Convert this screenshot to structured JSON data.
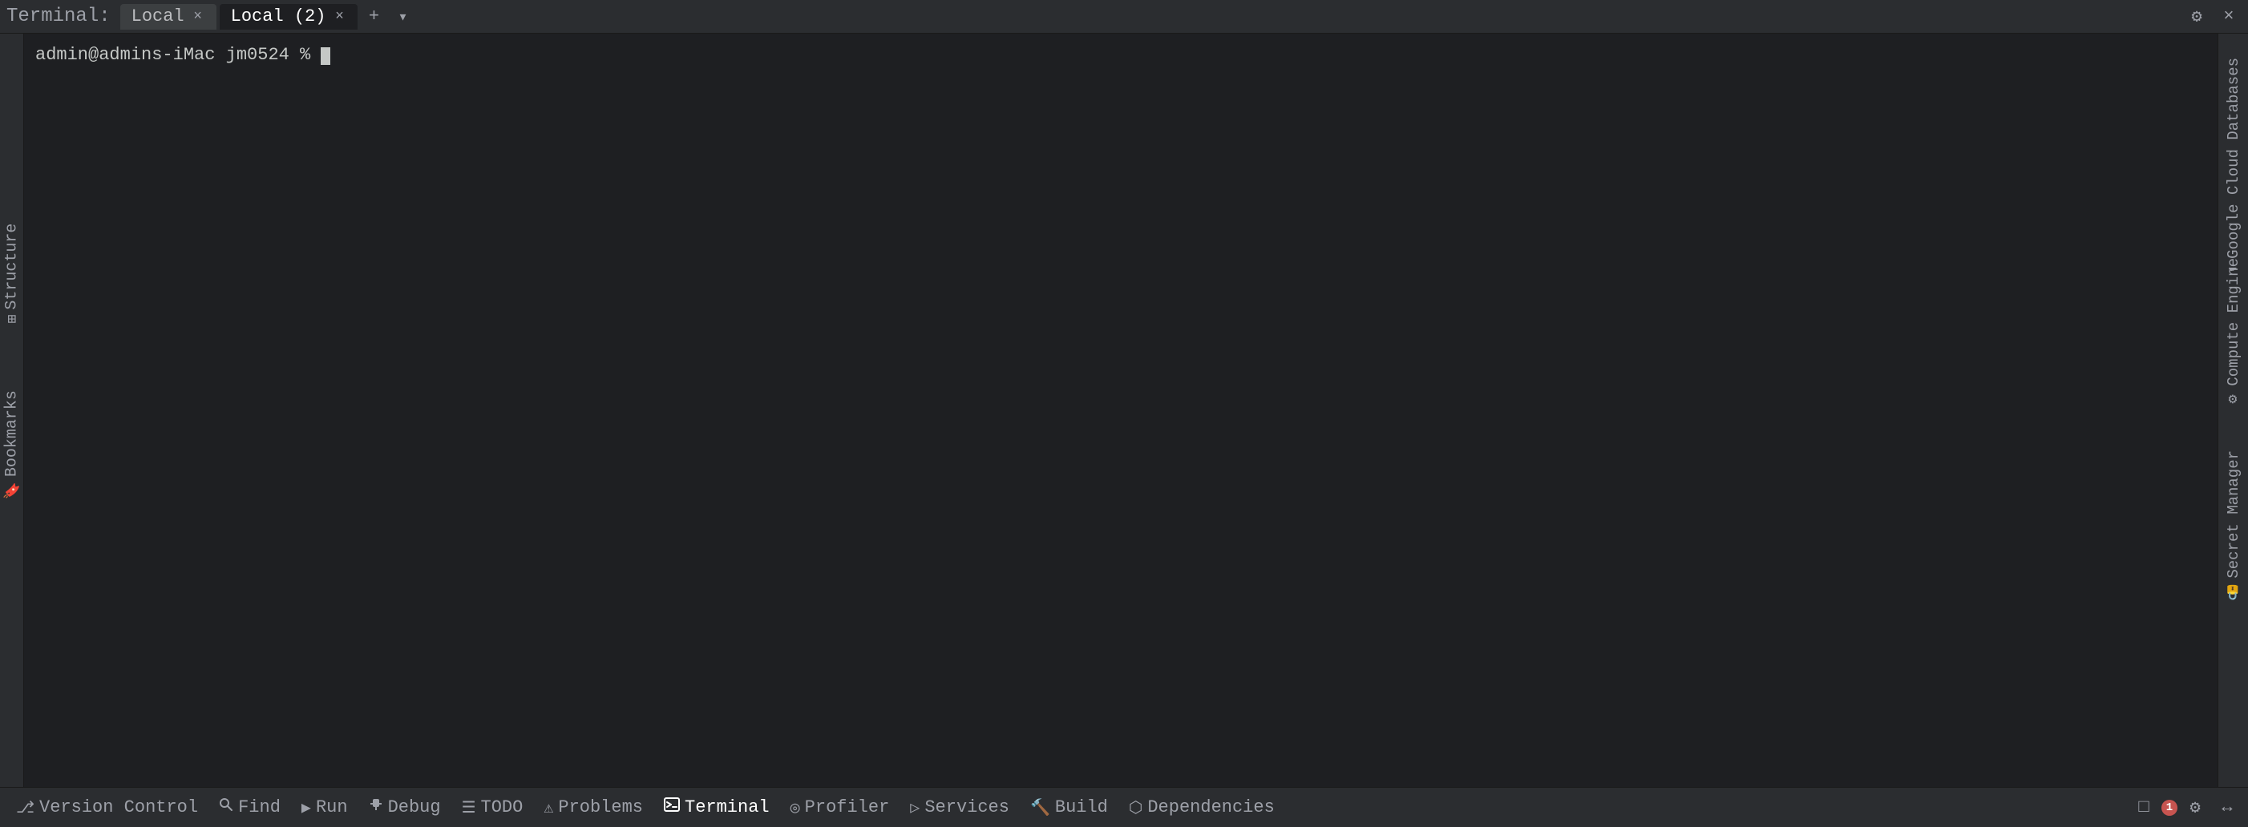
{
  "title_bar": {
    "label": "Terminal:",
    "tabs": [
      {
        "id": "local1",
        "label": "Local",
        "active": false,
        "closeable": true
      },
      {
        "id": "local2",
        "label": "Local (2)",
        "active": true,
        "closeable": true
      }
    ],
    "add_label": "+",
    "dropdown_label": "▾",
    "settings_icon": "⚙",
    "close_icon": "×"
  },
  "terminal": {
    "prompt": "admin@admins-iMac jm0524 %"
  },
  "left_sidebar": {
    "structure_label": "Structure",
    "bookmarks_label": "Bookmarks"
  },
  "right_sidebar": {
    "google_cloud_label": "Google Cloud Databases",
    "compute_label": "Compute Engine",
    "secret_label": "Secret Manager"
  },
  "bottom_toolbar": {
    "items": [
      {
        "id": "version-control",
        "icon": "⎇",
        "label": "Version Control"
      },
      {
        "id": "find",
        "icon": "🔍",
        "label": "Find"
      },
      {
        "id": "run",
        "icon": "▶",
        "label": "Run"
      },
      {
        "id": "debug",
        "icon": "🐛",
        "label": "Debug"
      },
      {
        "id": "todo",
        "icon": "☰",
        "label": "TODO"
      },
      {
        "id": "problems",
        "icon": "⚠",
        "label": "Problems"
      },
      {
        "id": "terminal",
        "icon": "▭",
        "label": "Terminal",
        "active": true
      },
      {
        "id": "profiler",
        "icon": "◎",
        "label": "Profiler"
      },
      {
        "id": "services",
        "icon": "▷",
        "label": "Services"
      },
      {
        "id": "build",
        "icon": "🔨",
        "label": "Build"
      },
      {
        "id": "dependencies",
        "icon": "⬡",
        "label": "Dependencies"
      }
    ]
  },
  "status_bar": {
    "expand_icon": "□",
    "error_count": "1",
    "settings_icon": "⚙",
    "arrow_icon": "↔"
  }
}
